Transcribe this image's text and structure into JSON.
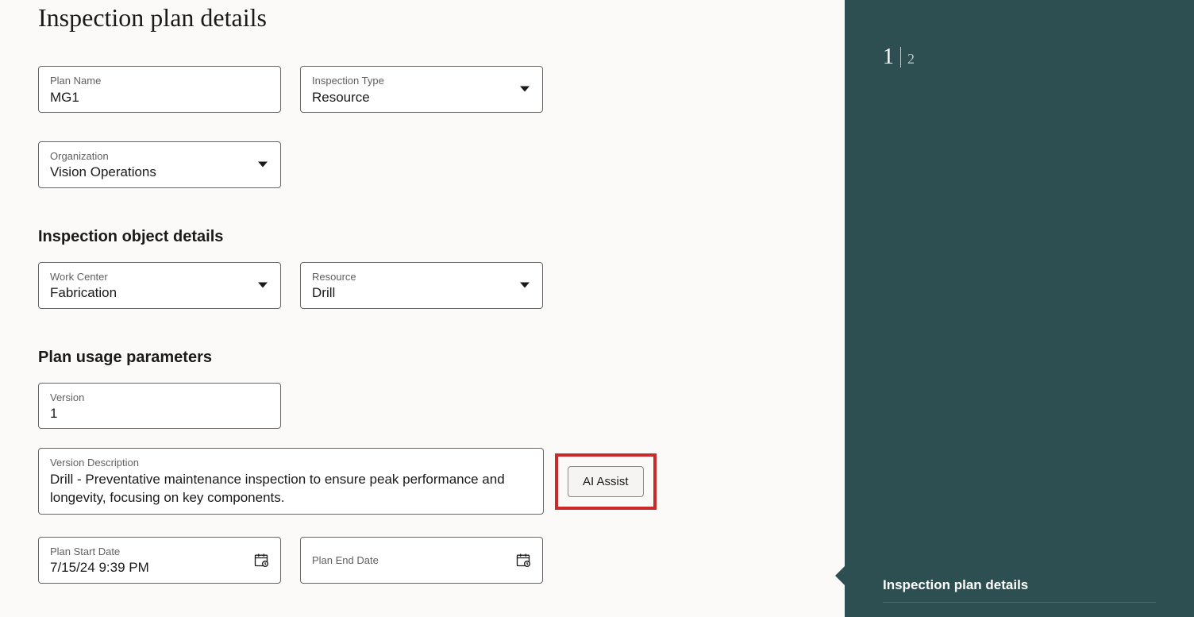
{
  "page": {
    "title": "Inspection plan details"
  },
  "planDetails": {
    "planName": {
      "label": "Plan Name",
      "value": "MG1"
    },
    "inspectionType": {
      "label": "Inspection Type",
      "value": "Resource"
    },
    "organization": {
      "label": "Organization",
      "value": "Vision Operations"
    }
  },
  "objectDetails": {
    "sectionTitle": "Inspection object details",
    "workCenter": {
      "label": "Work Center",
      "value": "Fabrication"
    },
    "resource": {
      "label": "Resource",
      "value": "Drill"
    }
  },
  "usage": {
    "sectionTitle": "Plan usage parameters",
    "version": {
      "label": "Version",
      "value": "1"
    },
    "versionDescription": {
      "label": "Version Description",
      "value": "Drill - Preventative maintenance inspection to ensure peak performance and longevity, focusing on key components."
    },
    "aiAssistLabel": "AI Assist",
    "planStartDate": {
      "label": "Plan Start Date",
      "value": "7/15/24 9:39 PM"
    },
    "planEndDate": {
      "label": "Plan End Date",
      "value": ""
    }
  },
  "sidebar": {
    "currentStep": "1",
    "totalSteps": "2",
    "stepLabel": "Inspection plan details"
  }
}
